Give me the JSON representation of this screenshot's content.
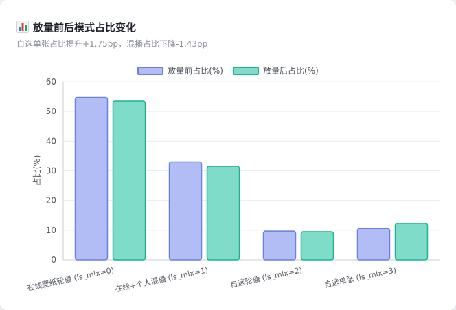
{
  "header": {
    "title": "放量前后模式占比变化",
    "subtitle": "自选单张占比提升+1.75pp，混播占比下降-1.43pp",
    "icon": "bar-chart-icon"
  },
  "chart_data": {
    "type": "bar",
    "categories": [
      "在线壁纸轮播 (ls_mix=0)",
      "在线+个人混播 (ls_mix=1)",
      "自选轮播 (ls_mix=2)",
      "自选单张 (ls_mix=3)"
    ],
    "series": [
      {
        "name": "放量前占比(%)",
        "values": [
          54.8,
          33.0,
          9.7,
          10.6
        ],
        "fill": "#b3bdf5",
        "stroke": "#6a7fe0"
      },
      {
        "name": "放量后占比(%)",
        "values": [
          53.5,
          31.5,
          9.5,
          12.3
        ],
        "fill": "#7fdcc8",
        "stroke": "#1db48f"
      }
    ],
    "xlabel": "",
    "ylabel": "占比(%)",
    "ylim": [
      0,
      60
    ],
    "yticks": [
      0,
      10,
      20,
      30,
      40,
      50,
      60
    ],
    "grid": true,
    "legend_position": "top-center"
  }
}
